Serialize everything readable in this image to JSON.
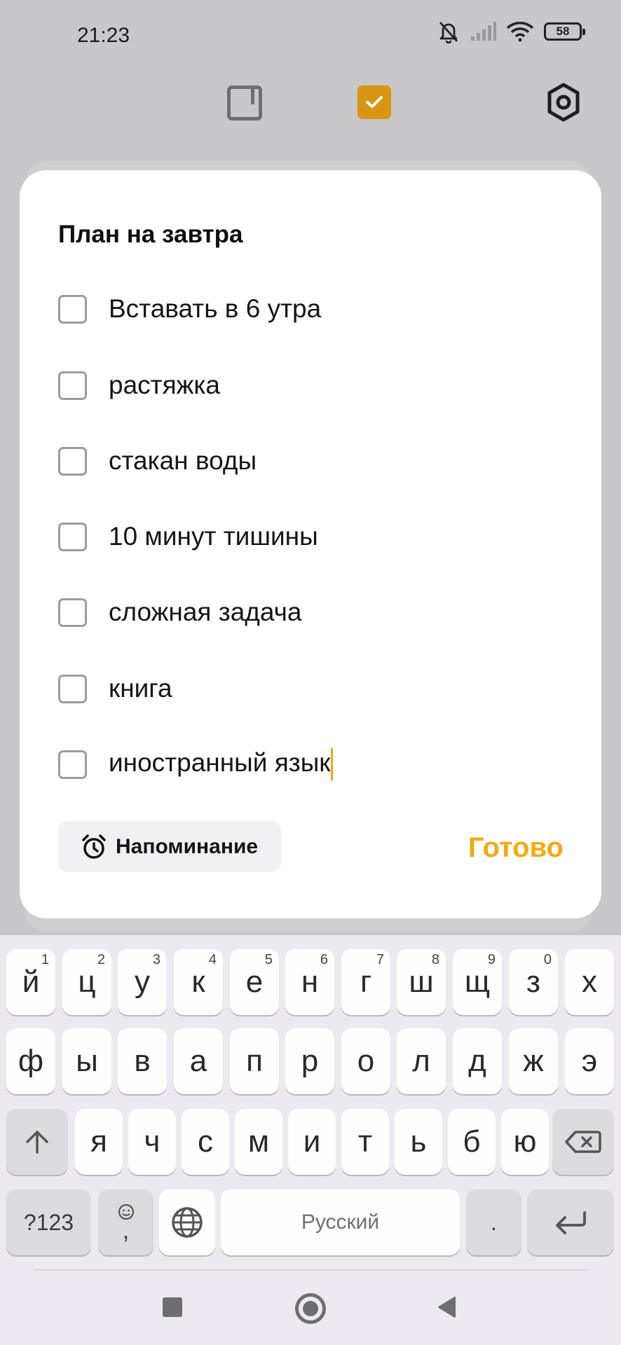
{
  "status_bar": {
    "time": "21:23",
    "battery": "58"
  },
  "colors": {
    "accent": "#f3aa14",
    "toolbar_check": "#d89614"
  },
  "toolbar": {
    "icons": [
      "note-icon",
      "checklist-icon",
      "settings-gear-icon"
    ]
  },
  "dialog": {
    "title": "План на завтра",
    "items": [
      {
        "text": "Вставать в 6 утра",
        "checked": false
      },
      {
        "text": "растяжка",
        "checked": false
      },
      {
        "text": "стакан воды",
        "checked": false
      },
      {
        "text": "10 минут тишины",
        "checked": false
      },
      {
        "text": "сложная задача",
        "checked": false
      },
      {
        "text": "книга",
        "checked": false
      },
      {
        "text": "иностранный язык",
        "checked": false
      }
    ],
    "reminder_label": "Напоминание",
    "done_label": "Готово"
  },
  "keyboard": {
    "row1": [
      {
        "k": "й",
        "h": "1"
      },
      {
        "k": "ц",
        "h": "2"
      },
      {
        "k": "у",
        "h": "3"
      },
      {
        "k": "к",
        "h": "4"
      },
      {
        "k": "е",
        "h": "5"
      },
      {
        "k": "н",
        "h": "6"
      },
      {
        "k": "г",
        "h": "7"
      },
      {
        "k": "ш",
        "h": "8"
      },
      {
        "k": "щ",
        "h": "9"
      },
      {
        "k": "з",
        "h": "0"
      },
      {
        "k": "х",
        "h": ""
      }
    ],
    "row2": [
      "ф",
      "ы",
      "в",
      "а",
      "п",
      "р",
      "о",
      "л",
      "д",
      "ж",
      "э"
    ],
    "row3": [
      "я",
      "ч",
      "с",
      "м",
      "и",
      "т",
      "ь",
      "б",
      "ю"
    ],
    "symbols_label": "?123",
    "emoji_comma_label": ",",
    "space_label": "Русский",
    "period_label": "."
  }
}
